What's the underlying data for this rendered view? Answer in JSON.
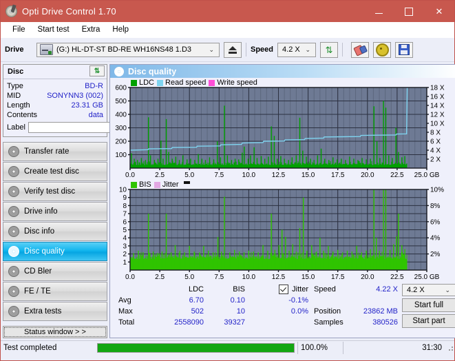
{
  "window": {
    "title": "Opti Drive Control 1.70",
    "icon": "disc-icon",
    "minimize": "—",
    "maximize": "□",
    "close": "✕"
  },
  "menu": [
    {
      "label": "File"
    },
    {
      "label": "Start test"
    },
    {
      "label": "Extra"
    },
    {
      "label": "Help"
    }
  ],
  "toolbar": {
    "drive_label": "Drive",
    "drive_value": "(G:)  HL-DT-ST BD-RE  WH16NS48 1.D3",
    "eject_icon": "eject-icon",
    "speed_label": "Speed",
    "speed_value": "4.2 X",
    "refresh_icon": "refresh-icon",
    "erase_icon": "eraser-icon",
    "settings_icon": "gear-icon",
    "save_icon": "save-icon",
    "chevron": "⌄"
  },
  "disc": {
    "header": "Disc",
    "refresh_icon": "refresh-icon",
    "rows": [
      {
        "key": "Type",
        "value": "BD-R"
      },
      {
        "key": "MID",
        "value": "SONYNN3 (002)"
      },
      {
        "key": "Length",
        "value": "23.31 GB"
      },
      {
        "key": "Contents",
        "value": "data"
      }
    ],
    "label_key": "Label",
    "label_value": "",
    "label_placeholder": "",
    "label_button_icon": "cd-icon"
  },
  "nav": {
    "items": [
      {
        "label": "Transfer rate",
        "icon": "disc-icon",
        "selected": false
      },
      {
        "label": "Create test disc",
        "icon": "disc-icon",
        "selected": false
      },
      {
        "label": "Verify test disc",
        "icon": "disc-icon",
        "selected": false
      },
      {
        "label": "Drive info",
        "icon": "disc-icon",
        "selected": false
      },
      {
        "label": "Disc info",
        "icon": "disc-icon",
        "selected": false
      },
      {
        "label": "Disc quality",
        "icon": "disc-icon",
        "selected": true
      },
      {
        "label": "CD Bler",
        "icon": "disc-icon",
        "selected": false
      },
      {
        "label": "FE / TE",
        "icon": "disc-icon",
        "selected": false
      },
      {
        "label": "Extra tests",
        "icon": "disc-icon",
        "selected": false
      }
    ],
    "status_window": "Status window > >"
  },
  "main": {
    "header": "Disc quality",
    "header_icon": "disc-icon"
  },
  "stats": {
    "col_headers": [
      "LDC",
      "BIS"
    ],
    "row_labels": [
      "Avg",
      "Max",
      "Total"
    ],
    "ldc": [
      "6.70",
      "502",
      "2558090"
    ],
    "bis": [
      "0.10",
      "10",
      "39327"
    ],
    "jitter_label": "Jitter",
    "jitter_checked": true,
    "jitter_values": [
      "-0.1%",
      "0.0%"
    ],
    "speed_label": "Speed",
    "speed_value": "4.22 X",
    "position_label": "Position",
    "position_value": "23862 MB",
    "samples_label": "Samples",
    "samples_value": "380526",
    "speed_select": "4.2 X",
    "speed_chevron": "⌄",
    "start_full": "Start full",
    "start_part": "Start part"
  },
  "statusbar": {
    "message": "Test completed",
    "percent": "100.0%",
    "percent_value": 100,
    "elapsed": "31:30"
  },
  "colors": {
    "titlebar": "#c8584e",
    "accent_blue": "#2323c8",
    "ldc_green": "#00a000",
    "bis_green": "#2fc400",
    "read_speed": "#7fd4f0",
    "write_speed": "#ff4fd8",
    "plot_bg": "#6e7a94",
    "progress": "#12a612",
    "selected_nav": "#12b5ee"
  },
  "chart_data": [
    {
      "type": "line",
      "title": "LDC / Read speed",
      "xlabel": "GB",
      "ylabel": "LDC",
      "xlim": [
        0,
        25.0
      ],
      "xticks": [
        0.0,
        2.5,
        5.0,
        7.5,
        10.0,
        12.5,
        15.0,
        17.5,
        20.0,
        22.5,
        25.0
      ],
      "xtick_labels": [
        "0.0",
        "2.5",
        "5.0",
        "7.5",
        "10.0",
        "12.5",
        "15.0",
        "17.5",
        "20.0",
        "22.5",
        "25.0 GB"
      ],
      "ylim": [
        0,
        600
      ],
      "yticks": [
        100,
        200,
        300,
        400,
        500,
        600
      ],
      "ytick_labels": [
        "100",
        "200",
        "300",
        "400",
        "500",
        "600"
      ],
      "y2lim": [
        0,
        18
      ],
      "y2ticks": [
        2,
        4,
        6,
        8,
        10,
        12,
        14,
        16,
        18
      ],
      "y2tick_labels": [
        "2 X",
        "4 X",
        "6 X",
        "8 X",
        "10 X",
        "12 X",
        "14 X",
        "16 X",
        "18 X"
      ],
      "grid": true,
      "legend": [
        {
          "name": "LDC",
          "color": "#00a000"
        },
        {
          "name": "Read speed",
          "color": "#7fd4f0"
        },
        {
          "name": "Write speed",
          "color": "#ff4fd8"
        }
      ],
      "series": [
        {
          "name": "LDC",
          "color": "#00a000",
          "kind": "spikes",
          "x_end": 23.35,
          "baseline": 22,
          "noise": 26,
          "spikes": [
            [
              0.12,
              110
            ],
            [
              0.35,
              70
            ],
            [
              0.62,
              60
            ],
            [
              0.95,
              75
            ],
            [
              1.3,
              60
            ],
            [
              1.55,
              378
            ],
            [
              1.72,
              95
            ],
            [
              2.05,
              60
            ],
            [
              2.35,
              70
            ],
            [
              2.6,
              205
            ],
            [
              2.78,
              70
            ],
            [
              3.05,
              365
            ],
            [
              3.25,
              120
            ],
            [
              3.55,
              70
            ],
            [
              3.85,
              85
            ],
            [
              4.15,
              60
            ],
            [
              4.45,
              95
            ],
            [
              4.8,
              65
            ],
            [
              5.1,
              70
            ],
            [
              5.45,
              60
            ],
            [
              5.75,
              105
            ],
            [
              6.05,
              70
            ],
            [
              6.35,
              60
            ],
            [
              6.7,
              80
            ],
            [
              7.05,
              65
            ],
            [
              7.35,
              200
            ],
            [
              7.62,
              80
            ],
            [
              7.95,
              465
            ],
            [
              8.2,
              95
            ],
            [
              8.55,
              60
            ],
            [
              8.85,
              70
            ],
            [
              9.15,
              65
            ],
            [
              9.45,
              115
            ],
            [
              9.62,
              160
            ],
            [
              9.95,
              70
            ],
            [
              10.15,
              95
            ],
            [
              10.45,
              155
            ],
            [
              10.7,
              75
            ],
            [
              11.05,
              90
            ],
            [
              11.35,
              70
            ],
            [
              11.65,
              85
            ],
            [
              11.9,
              310
            ],
            [
              12.15,
              240
            ],
            [
              12.4,
              70
            ],
            [
              12.7,
              90
            ],
            [
              13.0,
              70
            ],
            [
              13.35,
              60
            ],
            [
              13.65,
              80
            ],
            [
              14.0,
              95
            ],
            [
              14.3,
              375
            ],
            [
              14.55,
              130
            ],
            [
              14.85,
              85
            ],
            [
              15.2,
              70
            ],
            [
              15.5,
              60
            ],
            [
              15.8,
              95
            ],
            [
              16.1,
              145
            ],
            [
              16.4,
              70
            ],
            [
              16.75,
              60
            ],
            [
              17.1,
              80
            ],
            [
              17.45,
              65
            ],
            [
              17.8,
              70
            ],
            [
              18.15,
              60
            ],
            [
              18.5,
              85
            ],
            [
              18.85,
              70
            ],
            [
              19.2,
              60
            ],
            [
              19.55,
              75
            ],
            [
              19.9,
              65
            ],
            [
              20.25,
              70
            ],
            [
              20.55,
              460
            ],
            [
              20.8,
              200
            ],
            [
              21.05,
              75
            ],
            [
              21.35,
              500
            ],
            [
              21.55,
              450
            ],
            [
              21.8,
              95
            ],
            [
              22.1,
              75
            ],
            [
              22.4,
              300
            ],
            [
              22.62,
              120
            ],
            [
              22.9,
              80
            ],
            [
              23.15,
              90
            ]
          ]
        },
        {
          "name": "Read speed",
          "color": "#7fd4f0",
          "kind": "line",
          "points": [
            [
              0.0,
              4.0
            ],
            [
              1.5,
              4.1
            ],
            [
              1.55,
              4.3
            ],
            [
              3.5,
              4.35
            ],
            [
              3.55,
              4.6
            ],
            [
              5.6,
              4.65
            ],
            [
              5.65,
              4.9
            ],
            [
              7.6,
              4.95
            ],
            [
              7.65,
              5.2
            ],
            [
              9.4,
              5.3
            ],
            [
              9.45,
              5.6
            ],
            [
              11.2,
              5.7
            ],
            [
              11.25,
              6.0
            ],
            [
              13.0,
              6.05
            ],
            [
              13.05,
              6.3
            ],
            [
              14.7,
              6.35
            ],
            [
              14.75,
              6.6
            ],
            [
              16.3,
              6.7
            ],
            [
              16.35,
              6.95
            ],
            [
              17.9,
              7.0
            ],
            [
              19.4,
              7.05
            ],
            [
              19.45,
              7.3
            ],
            [
              21.0,
              7.35
            ],
            [
              22.4,
              7.4
            ],
            [
              22.45,
              7.6
            ],
            [
              23.3,
              7.65
            ],
            [
              23.35,
              18.0
            ]
          ]
        }
      ]
    },
    {
      "type": "line",
      "title": "BIS / Jitter",
      "xlabel": "GB",
      "ylabel": "BIS",
      "xlim": [
        0,
        25.0
      ],
      "xticks": [
        0.0,
        2.5,
        5.0,
        7.5,
        10.0,
        12.5,
        15.0,
        17.5,
        20.0,
        22.5,
        25.0
      ],
      "xtick_labels": [
        "0.0",
        "2.5",
        "5.0",
        "7.5",
        "10.0",
        "12.5",
        "15.0",
        "17.5",
        "20.0",
        "22.5",
        "25.0 GB"
      ],
      "ylim": [
        0,
        10
      ],
      "yticks": [
        1,
        2,
        3,
        4,
        5,
        6,
        7,
        8,
        9,
        10
      ],
      "ytick_labels": [
        "1",
        "2",
        "3",
        "4",
        "5",
        "6",
        "7",
        "8",
        "9",
        "10"
      ],
      "y2lim": [
        0,
        10
      ],
      "y2ticks": [
        2,
        4,
        6,
        8,
        10
      ],
      "y2tick_labels": [
        "2%",
        "4%",
        "6%",
        "8%",
        "10%"
      ],
      "grid": true,
      "legend": [
        {
          "name": "BIS",
          "color": "#2fc400"
        },
        {
          "name": "Jitter",
          "color": "#e3a8e3"
        }
      ],
      "series": [
        {
          "name": "BIS",
          "color": "#2fc400",
          "kind": "spikes",
          "x_end": 23.35,
          "baseline": 1.35,
          "noise": 0.75,
          "spikes": [
            [
              0.3,
              2.1
            ],
            [
              0.7,
              2.4
            ],
            [
              1.1,
              2.2
            ],
            [
              1.55,
              7.0
            ],
            [
              1.95,
              2.3
            ],
            [
              2.3,
              2.1
            ],
            [
              2.7,
              2.3
            ],
            [
              3.05,
              7.0
            ],
            [
              3.45,
              2.2
            ],
            [
              3.8,
              3.1
            ],
            [
              4.2,
              2.4
            ],
            [
              4.6,
              2.2
            ],
            [
              5.0,
              3.0
            ],
            [
              5.4,
              2.3
            ],
            [
              5.85,
              2.2
            ],
            [
              6.2,
              3.0
            ],
            [
              6.6,
              2.4
            ],
            [
              7.0,
              2.2
            ],
            [
              7.4,
              4.1
            ],
            [
              7.7,
              2.3
            ],
            [
              7.95,
              9.1
            ],
            [
              8.4,
              2.2
            ],
            [
              8.8,
              2.5
            ],
            [
              9.2,
              2.3
            ],
            [
              9.6,
              2.2
            ],
            [
              10.0,
              2.4
            ],
            [
              10.4,
              2.3
            ],
            [
              10.8,
              2.2
            ],
            [
              11.2,
              3.1
            ],
            [
              11.6,
              2.4
            ],
            [
              11.9,
              7.0
            ],
            [
              12.2,
              2.5
            ],
            [
              12.55,
              3.1
            ],
            [
              12.8,
              5.0
            ],
            [
              13.1,
              4.1
            ],
            [
              13.4,
              2.4
            ],
            [
              13.7,
              3.2
            ],
            [
              14.0,
              2.3
            ],
            [
              14.3,
              5.2
            ],
            [
              14.6,
              9.0
            ],
            [
              14.9,
              2.4
            ],
            [
              15.3,
              3.1
            ],
            [
              15.7,
              2.3
            ],
            [
              16.0,
              4.0
            ],
            [
              16.3,
              2.4
            ],
            [
              16.7,
              3.0
            ],
            [
              17.1,
              2.3
            ],
            [
              17.5,
              2.5
            ],
            [
              17.9,
              2.2
            ],
            [
              18.3,
              2.4
            ],
            [
              18.7,
              2.3
            ],
            [
              19.1,
              3.0
            ],
            [
              19.5,
              2.2
            ],
            [
              19.9,
              2.4
            ],
            [
              20.25,
              2.6
            ],
            [
              20.55,
              10.0
            ],
            [
              20.75,
              4.0
            ],
            [
              21.0,
              2.4
            ],
            [
              21.35,
              10.0
            ],
            [
              21.55,
              10.0
            ],
            [
              21.9,
              2.5
            ],
            [
              22.2,
              3.2
            ],
            [
              22.45,
              4.2
            ],
            [
              22.62,
              7.0
            ],
            [
              22.9,
              3.1
            ],
            [
              23.15,
              2.6
            ]
          ]
        },
        {
          "name": "Jitter",
          "color": "#e3a8e3",
          "kind": "line",
          "points": []
        }
      ]
    }
  ]
}
